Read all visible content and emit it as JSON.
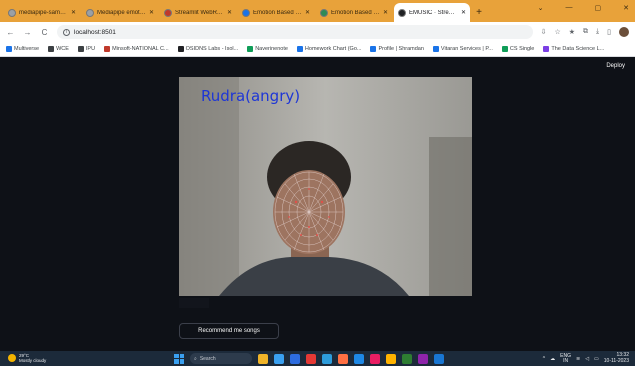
{
  "browser": {
    "tabs": [
      {
        "label": "mediapipe-samples/ README",
        "favicon_color": "#9aa0a6",
        "active": false
      },
      {
        "label": "Mediapipe emotion detection",
        "favicon_color": "#9aa0a6",
        "active": false
      },
      {
        "label": "Streamlit WebRTC example",
        "favicon_color": "#c0392b",
        "active": false
      },
      {
        "label": "Emotion Based Music Recommender",
        "favicon_color": "#1a73e8",
        "active": false
      },
      {
        "label": "Emotion Based Music — Video",
        "favicon_color": "#2e8b57",
        "active": false
      },
      {
        "label": "EMUSIC · Streamlit",
        "favicon_color": "#202124",
        "active": true
      }
    ],
    "new_tab_symbol": "+",
    "window_controls": [
      "⌄",
      "—",
      "▢",
      "✕"
    ],
    "nav": {
      "back": "←",
      "forward": "→",
      "reload": "C"
    },
    "url": "localhost:8501",
    "info_icon": "i",
    "toolbar_icons": [
      "⇩",
      "☆",
      "★",
      "⧉",
      "⤓",
      "▯"
    ],
    "bookmarks": [
      {
        "label": "Multiverse",
        "color": "#1a73e8"
      },
      {
        "label": "WCE",
        "color": "#3c4043"
      },
      {
        "label": "IPU",
        "color": "#3c4043"
      },
      {
        "label": "Minsoft-NATIONAL C...",
        "color": "#c0392b"
      },
      {
        "label": "OSIDNS Labs - Isol...",
        "color": "#202124"
      },
      {
        "label": "Naverinenote",
        "color": "#0f9d58"
      },
      {
        "label": "Homework Chart (Go...",
        "color": "#1a73e8"
      },
      {
        "label": "Profile | Shramdan",
        "color": "#1a73e8"
      },
      {
        "label": "Vitaran Services | P...",
        "color": "#1a73e8"
      },
      {
        "label": "CS Single",
        "color": "#0f9d58"
      },
      {
        "label": "The Data Science L...",
        "color": "#7b3fe4"
      }
    ]
  },
  "app": {
    "deploy_label": "Deploy",
    "overlay_label": "Rudra(angry)",
    "overlay_color": "#1e36d6",
    "recommend_button_label": "Recommend me songs"
  },
  "taskbar": {
    "weather_temp": "29°C",
    "weather_desc": "Mostly cloudy",
    "search_placeholder": "Search",
    "app_colors": [
      "#f0b429",
      "#3aa0f0",
      "#2d6cdf",
      "#e53935",
      "#2d9cdb",
      "#ff7043",
      "#1e88e5",
      "#e91e63",
      "#ffb300",
      "#2e7d32",
      "#8e24aa",
      "#1976d2"
    ],
    "tray_lang_top": "ENG",
    "tray_lang_bottom": "IN",
    "time": "13:32",
    "date": "10-11-2023"
  }
}
